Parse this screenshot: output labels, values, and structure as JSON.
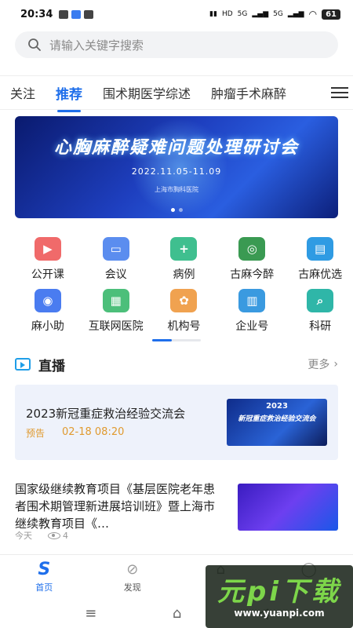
{
  "status_bar": {
    "time": "20:34",
    "network_left": "HD",
    "signal_a": "5G",
    "signal_b": "5G",
    "battery": "61"
  },
  "search": {
    "placeholder": "请输入关键字搜索"
  },
  "tabs": [
    "关注",
    "推荐",
    "围术期医学综述",
    "肿瘤手术麻醉"
  ],
  "active_tab_index": 1,
  "banner": {
    "title": "心胸麻醉疑难问题处理研讨会",
    "date": "2022.11.05-11.09",
    "organizer": "上海市胸科医院",
    "slide_count": 2,
    "active_slide": 0
  },
  "grid": {
    "row1": [
      {
        "label": "公开课",
        "icon": "video-camera-icon",
        "color": "#f06a6a",
        "glyph": "▶"
      },
      {
        "label": "会议",
        "icon": "presentation-board-icon",
        "color": "#5b8def",
        "glyph": "▭"
      },
      {
        "label": "病例",
        "icon": "medical-clipboard-icon",
        "color": "#3fbf8f",
        "glyph": "+"
      },
      {
        "label": "古麻今醉",
        "icon": "journal-seal-icon",
        "color": "#3a9a52",
        "glyph": "◎"
      },
      {
        "label": "古麻优选",
        "icon": "book-icon",
        "color": "#2f9be3",
        "glyph": "▤"
      }
    ],
    "row2": [
      {
        "label": "麻小助",
        "icon": "robot-assistant-icon",
        "color": "#4a7cf0",
        "glyph": "◉"
      },
      {
        "label": "互联网医院",
        "icon": "hospital-building-icon",
        "color": "#4cbf7a",
        "glyph": "▦"
      },
      {
        "label": "机构号",
        "icon": "institution-badge-icon",
        "color": "#f0a250",
        "glyph": "✿"
      },
      {
        "label": "企业号",
        "icon": "enterprise-building-icon",
        "color": "#3a9ae0",
        "glyph": "▥"
      },
      {
        "label": "科研",
        "icon": "research-magnifier-icon",
        "color": "#2fb6a8",
        "glyph": "⌕"
      }
    ]
  },
  "live": {
    "section_title": "直播",
    "more_label": "更多",
    "item": {
      "title": "2023新冠重症救治经验交流会",
      "badge": "预告",
      "time": "02-18 08:20",
      "thumb_year": "2023",
      "thumb_title": "新冠重症救治经验交流会"
    }
  },
  "article": {
    "title": "国家级继续教育项目《基层医院老年患者围术期管理新进展培训班》暨上海市继续教育项目《…",
    "date": "今天",
    "views": "4"
  },
  "bottom_nav": [
    {
      "label": "首页",
      "icon": "home-logo-icon",
      "active": true,
      "glyph": "S"
    },
    {
      "label": "发现",
      "icon": "compass-icon",
      "active": false,
      "glyph": "⊘"
    },
    {
      "label": "",
      "icon": "house-icon",
      "active": false,
      "glyph": "⌂"
    },
    {
      "label": "",
      "icon": "message-icon",
      "active": false,
      "glyph": "◯"
    }
  ],
  "watermark": {
    "text": "元pi下载",
    "url": "www.yuanpi.com"
  }
}
